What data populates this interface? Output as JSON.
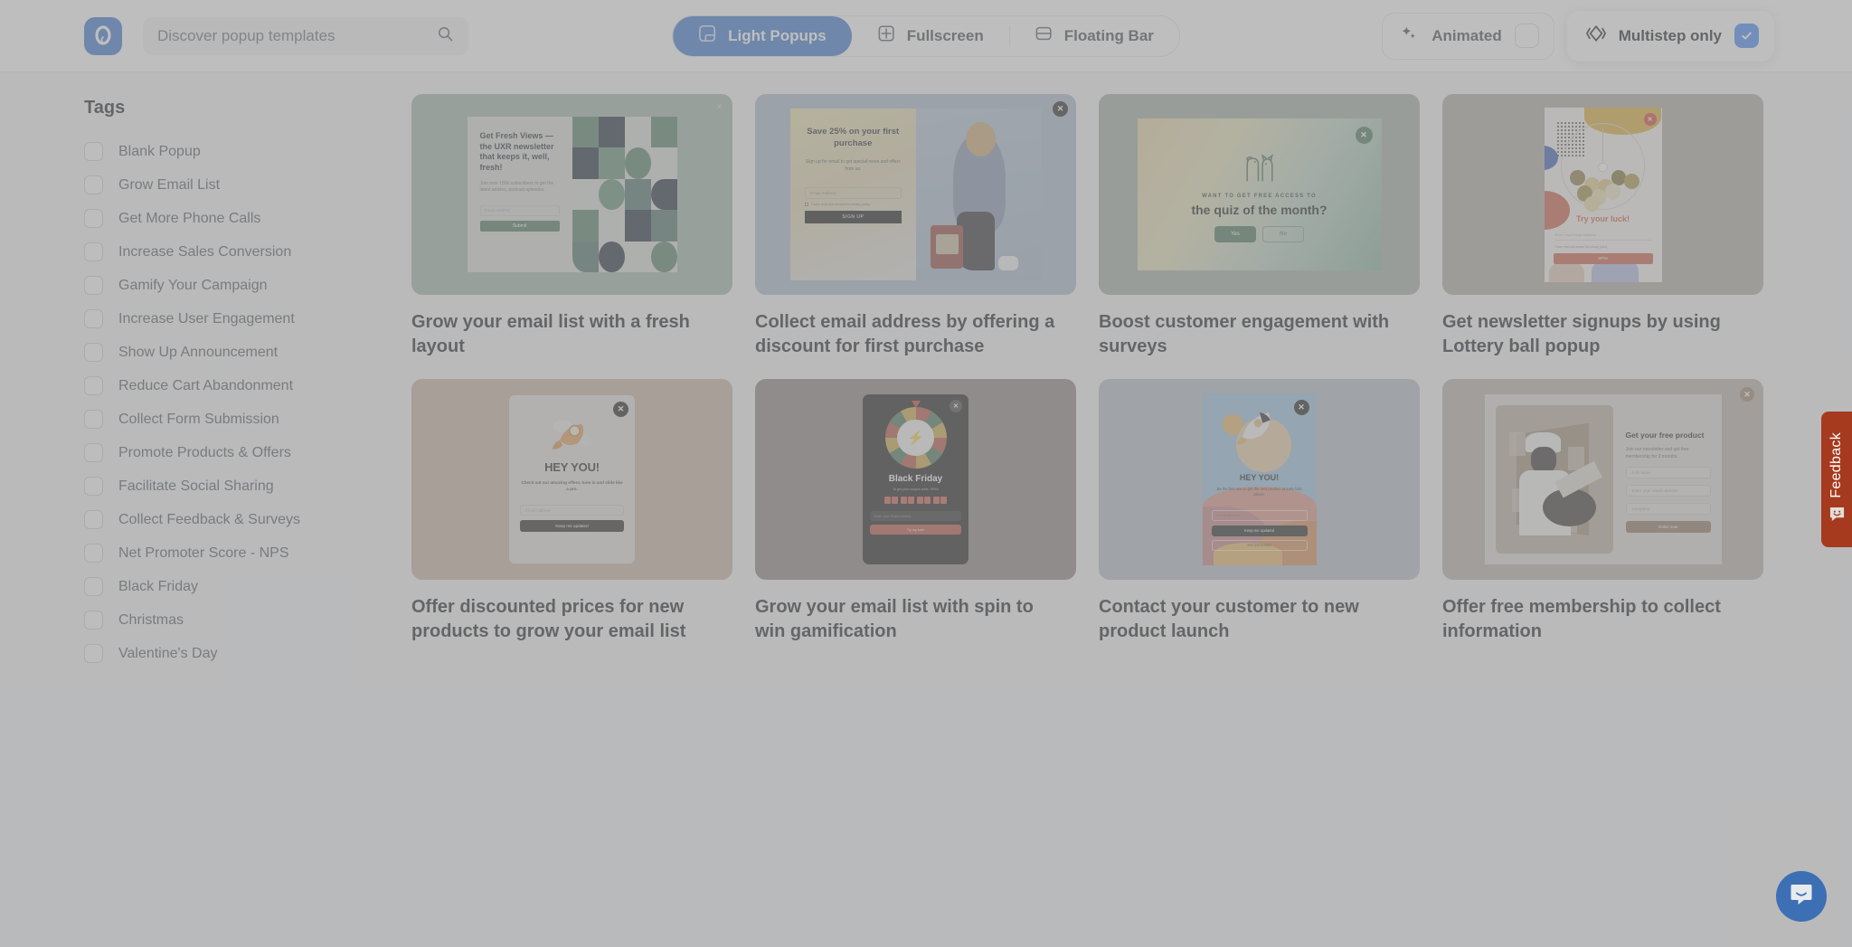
{
  "header": {
    "logo_icon": "popupsmart-logo-icon",
    "search": {
      "placeholder": "Discover popup templates",
      "value": "",
      "icon": "search-icon"
    },
    "tabs": [
      {
        "label": "Light Popups",
        "icon": "light-popup-icon",
        "active": true
      },
      {
        "label": "Fullscreen",
        "icon": "fullscreen-icon",
        "active": false
      },
      {
        "label": "Floating Bar",
        "icon": "floating-bar-icon",
        "active": false
      }
    ],
    "filters": [
      {
        "label": "Animated",
        "icon": "sparkle-icon",
        "checked": false
      },
      {
        "label": "Multistep only",
        "icon": "multistep-diamond-icon",
        "checked": true
      }
    ]
  },
  "sidebar": {
    "title": "Tags",
    "tags": [
      {
        "label": "Blank Popup",
        "checked": false
      },
      {
        "label": "Grow Email List",
        "checked": false
      },
      {
        "label": "Get More Phone Calls",
        "checked": false
      },
      {
        "label": "Increase Sales Conversion",
        "checked": false
      },
      {
        "label": "Gamify Your Campaign",
        "checked": false
      },
      {
        "label": "Increase User Engagement",
        "checked": false
      },
      {
        "label": "Show Up Announcement",
        "checked": false
      },
      {
        "label": "Reduce Cart Abandonment",
        "checked": false
      },
      {
        "label": "Collect Form Submission",
        "checked": false
      },
      {
        "label": "Promote Products & Offers",
        "checked": false
      },
      {
        "label": "Facilitate Social Sharing",
        "checked": false
      },
      {
        "label": "Collect Feedback & Surveys",
        "checked": false
      },
      {
        "label": "Net Promoter Score - NPS",
        "checked": false
      },
      {
        "label": "Black Friday",
        "checked": false
      },
      {
        "label": "Christmas",
        "checked": false
      },
      {
        "label": "Valentine's Day",
        "checked": false
      }
    ]
  },
  "templates": [
    {
      "title": "Grow your email list with a fresh layout",
      "preview": {
        "heading": "Get Fresh Views — the UXR newsletter that keeps it, well, fresh!",
        "body": "Join over 150k subscribers to get the latest articles, podcast episodes.",
        "input_placeholder": "Email Address",
        "button": "Submit"
      }
    },
    {
      "title": "Collect email address by offering a discount for first purchase",
      "preview": {
        "heading": "Save 25% on your first purchase",
        "body": "Sign up for email to get special news and offers from us.",
        "input_placeholder": "Email Address",
        "consent": "I have read and accept the privacy policy",
        "button": "SIGN UP"
      }
    },
    {
      "title": "Boost customer engagement with surveys",
      "preview": {
        "eyebrow": "WANT TO GET FREE ACCESS TO",
        "heading": "the quiz of the month?",
        "yes": "Yes",
        "no": "No"
      }
    },
    {
      "title": "Get newsletter signups by using Lottery ball popup",
      "preview": {
        "heading": "Try your luck!",
        "input_placeholder": "Enter Your Email Address",
        "consent": "I have read and accept the privacy policy",
        "button": "SPIN"
      }
    },
    {
      "title": "Offer discounted prices for new products to grow your email list",
      "preview": {
        "heading": "HEY YOU!",
        "body": "Check out our amazing offers, tune in and slide like a pro.",
        "input_placeholder": "Email Address",
        "button": "Keep me updated"
      }
    },
    {
      "title": "Grow your email list with spin to win gamification",
      "preview": {
        "heading": "Black Friday",
        "body": "To get your coupon code, SPIN!",
        "input_placeholder": "Enter your Email Address",
        "button": "Try my luck!"
      }
    },
    {
      "title": "Contact your customer to new product launch",
      "preview": {
        "heading": "HEY YOU!",
        "body": "Be the first one to get the new product at early bird prices.",
        "input_placeholder": "Email Address",
        "button": "Keep me updated",
        "button_secondary": "Not interested"
      }
    },
    {
      "title": "Offer free membership to collect information",
      "preview": {
        "heading": "Get your free product",
        "body": "Join our newsletter and get free membership for 3 months.",
        "name_placeholder": "Full name",
        "input_placeholder": "Enter your email address",
        "company_placeholder": "Company",
        "button": "Order now"
      }
    }
  ],
  "feedback": {
    "label": "Feedback",
    "icon": "smiley-chat-icon"
  },
  "chat": {
    "icon": "intercom-chat-icon"
  },
  "colors": {
    "accent": "#2f6ecb",
    "checkbox_checked": "#3b82f6",
    "feedback": "#a63a1e",
    "chat": "#3d6fb5"
  }
}
